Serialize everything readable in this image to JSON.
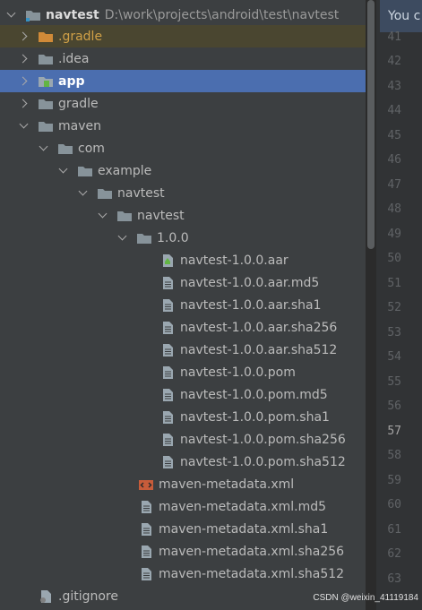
{
  "project": {
    "name": "navtest",
    "path": "D:\\work\\projects\\android\\test\\navtest"
  },
  "tree": {
    "gradle_label": ".gradle",
    "idea_label": ".idea",
    "app_label": "app",
    "gradle_dir_label": "gradle",
    "maven_label": "maven",
    "com_label": "com",
    "example_label": "example",
    "navtest1_label": "navtest",
    "navtest2_label": "navtest",
    "version_label": "1.0.0",
    "version_files": [
      "navtest-1.0.0.aar",
      "navtest-1.0.0.aar.md5",
      "navtest-1.0.0.aar.sha1",
      "navtest-1.0.0.aar.sha256",
      "navtest-1.0.0.aar.sha512",
      "navtest-1.0.0.pom",
      "navtest-1.0.0.pom.md5",
      "navtest-1.0.0.pom.sha1",
      "navtest-1.0.0.pom.sha256",
      "navtest-1.0.0.pom.sha512"
    ],
    "metadata_files": [
      "maven-metadata.xml",
      "maven-metadata.xml.md5",
      "maven-metadata.xml.sha1",
      "maven-metadata.xml.sha256",
      "maven-metadata.xml.sha512"
    ],
    "gitignore_label": ".gitignore"
  },
  "editor": {
    "banner_text": "You c",
    "line_numbers": [
      "41",
      "42",
      "43",
      "44",
      "45",
      "46",
      "47",
      "48",
      "49",
      "50",
      "51",
      "52",
      "53",
      "54",
      "55",
      "56",
      "57",
      "58",
      "59",
      "60",
      "61",
      "62",
      "63"
    ],
    "current_line": "57"
  },
  "watermark": "CSDN @weixin_41119184",
  "colors": {
    "selection": "#4b6eaf",
    "gradle_folder": "#d0a047",
    "panel_bg": "#3c3f41"
  }
}
